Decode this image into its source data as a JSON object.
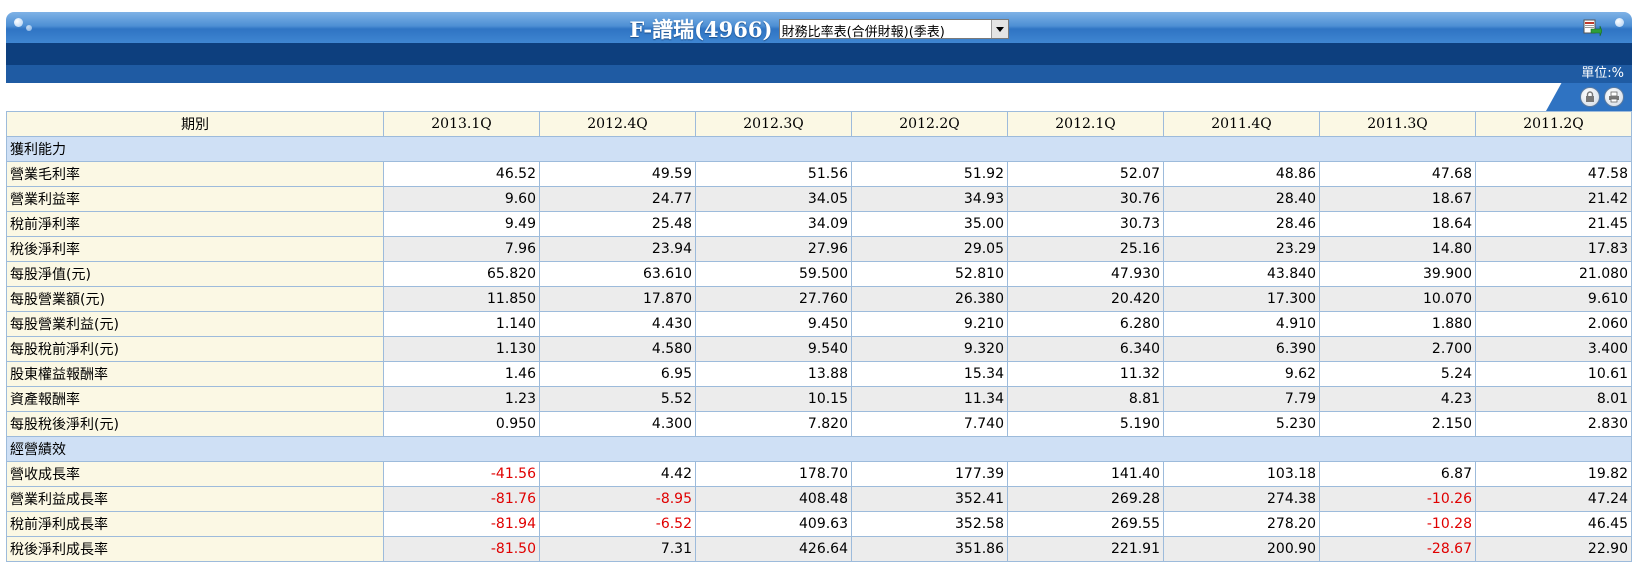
{
  "header": {
    "title": "F-譜瑞(4966)",
    "report_select": "財務比率表(合併財報)(季表)",
    "unit": "單位:%"
  },
  "icons": {
    "export": "excel-export-icon",
    "lock": "lock-icon",
    "print": "print-icon"
  },
  "table": {
    "period_header": "期別",
    "periods": [
      "2013.1Q",
      "2012.4Q",
      "2012.3Q",
      "2012.2Q",
      "2012.1Q",
      "2011.4Q",
      "2011.3Q",
      "2011.2Q"
    ],
    "sections": [
      {
        "name": "獲利能力",
        "rows": [
          {
            "label": "營業毛利率",
            "values": [
              "46.52",
              "49.59",
              "51.56",
              "51.92",
              "52.07",
              "48.86",
              "47.68",
              "47.58"
            ]
          },
          {
            "label": "營業利益率",
            "values": [
              "9.60",
              "24.77",
              "34.05",
              "34.93",
              "30.76",
              "28.40",
              "18.67",
              "21.42"
            ]
          },
          {
            "label": "稅前淨利率",
            "values": [
              "9.49",
              "25.48",
              "34.09",
              "35.00",
              "30.73",
              "28.46",
              "18.64",
              "21.45"
            ]
          },
          {
            "label": "稅後淨利率",
            "values": [
              "7.96",
              "23.94",
              "27.96",
              "29.05",
              "25.16",
              "23.29",
              "14.80",
              "17.83"
            ]
          },
          {
            "label": "每股淨值(元)",
            "values": [
              "65.820",
              "63.610",
              "59.500",
              "52.810",
              "47.930",
              "43.840",
              "39.900",
              "21.080"
            ]
          },
          {
            "label": "每股營業額(元)",
            "values": [
              "11.850",
              "17.870",
              "27.760",
              "26.380",
              "20.420",
              "17.300",
              "10.070",
              "9.610"
            ]
          },
          {
            "label": "每股營業利益(元)",
            "values": [
              "1.140",
              "4.430",
              "9.450",
              "9.210",
              "6.280",
              "4.910",
              "1.880",
              "2.060"
            ]
          },
          {
            "label": "每股稅前淨利(元)",
            "values": [
              "1.130",
              "4.580",
              "9.540",
              "9.320",
              "6.340",
              "6.390",
              "2.700",
              "3.400"
            ]
          },
          {
            "label": "股東權益報酬率",
            "values": [
              "1.46",
              "6.95",
              "13.88",
              "15.34",
              "11.32",
              "9.62",
              "5.24",
              "10.61"
            ]
          },
          {
            "label": "資產報酬率",
            "values": [
              "1.23",
              "5.52",
              "10.15",
              "11.34",
              "8.81",
              "7.79",
              "4.23",
              "8.01"
            ]
          },
          {
            "label": "每股稅後淨利(元)",
            "values": [
              "0.950",
              "4.300",
              "7.820",
              "7.740",
              "5.190",
              "5.230",
              "2.150",
              "2.830"
            ]
          }
        ]
      },
      {
        "name": "經營績效",
        "rows": [
          {
            "label": "營收成長率",
            "values": [
              "-41.56",
              "4.42",
              "178.70",
              "177.39",
              "141.40",
              "103.18",
              "6.87",
              "19.82"
            ]
          },
          {
            "label": "營業利益成長率",
            "values": [
              "-81.76",
              "-8.95",
              "408.48",
              "352.41",
              "269.28",
              "274.38",
              "-10.26",
              "47.24"
            ]
          },
          {
            "label": "稅前淨利成長率",
            "values": [
              "-81.94",
              "-6.52",
              "409.63",
              "352.58",
              "269.55",
              "278.20",
              "-10.28",
              "46.45"
            ]
          },
          {
            "label": "稅後淨利成長率",
            "values": [
              "-81.50",
              "7.31",
              "426.64",
              "351.86",
              "221.91",
              "200.90",
              "-28.67",
              "22.90"
            ]
          }
        ]
      }
    ]
  }
}
